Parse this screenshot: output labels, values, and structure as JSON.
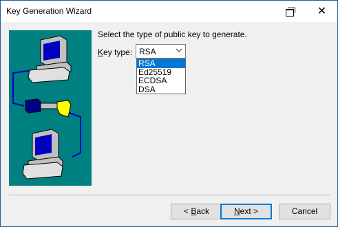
{
  "window": {
    "title": "Key Generation Wizard",
    "close_glyph": "✕"
  },
  "prompt": "Select the type of public key to generate.",
  "key_type": {
    "label_underlined": "K",
    "label_rest": "ey type:",
    "selected": "RSA",
    "options": [
      "RSA",
      "Ed25519",
      "ECDSA",
      "DSA"
    ]
  },
  "buttons": {
    "back_prefix": "< ",
    "back_underlined": "B",
    "back_rest": "ack",
    "next_underlined": "N",
    "next_rest": "ext >",
    "cancel": "Cancel"
  },
  "colors": {
    "illustration_bg": "#008080",
    "selection": "#0078d7"
  }
}
